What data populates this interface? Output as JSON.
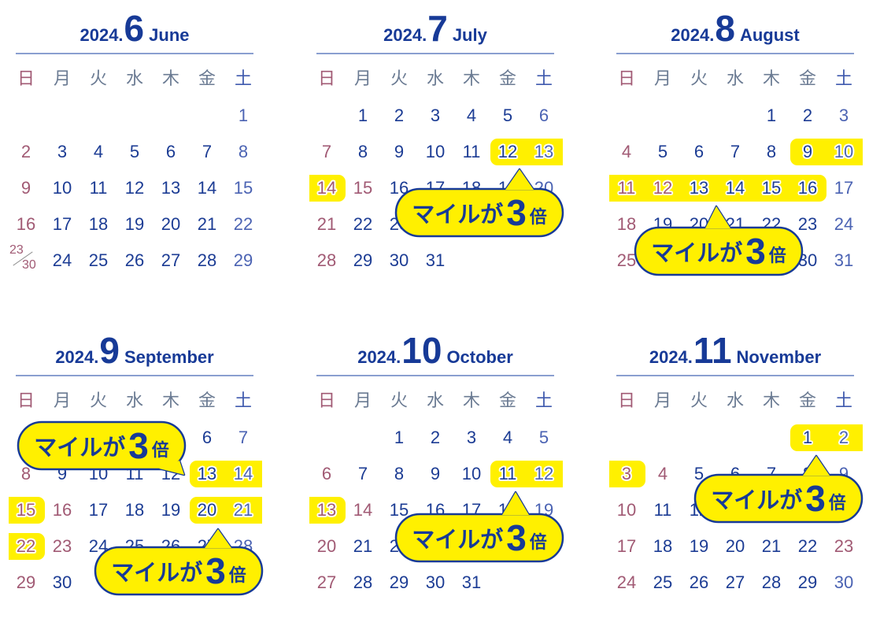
{
  "weekdays": [
    "日",
    "月",
    "火",
    "水",
    "木",
    "金",
    "土"
  ],
  "callout": {
    "prefix": "マイルが",
    "number": "3",
    "suffix": "倍"
  },
  "colors": {
    "weekday": "#1c3c94",
    "saturday": "#4b63b3",
    "sunday_holiday": "#a15a74",
    "highlight": "#fff000",
    "callout_fill": "#fff000",
    "callout_border": "#173a97"
  },
  "months": [
    {
      "year_label": "2024.",
      "month_number": "6",
      "month_name": "June",
      "first_weekday": 6,
      "days": 30,
      "holidays": [],
      "highlight_days": [],
      "callouts": 0
    },
    {
      "year_label": "2024.",
      "month_number": "7",
      "month_name": "July",
      "first_weekday": 1,
      "days": 31,
      "holidays": [
        15
      ],
      "highlight_days": [
        12,
        13,
        14
      ],
      "callouts": 1
    },
    {
      "year_label": "2024.",
      "month_number": "8",
      "month_name": "August",
      "first_weekday": 4,
      "days": 31,
      "holidays": [
        12
      ],
      "highlight_days": [
        9,
        10,
        11,
        12,
        13,
        14,
        15,
        16
      ],
      "callouts": 1
    },
    {
      "year_label": "2024.",
      "month_number": "9",
      "month_name": "September",
      "first_weekday": 0,
      "days": 30,
      "holidays": [
        16,
        23
      ],
      "highlight_days": [
        13,
        14,
        15,
        20,
        21,
        22
      ],
      "callouts": 2
    },
    {
      "year_label": "2024.",
      "month_number": "10",
      "month_name": "October",
      "first_weekday": 2,
      "days": 31,
      "holidays": [
        14
      ],
      "highlight_days": [
        11,
        12,
        13
      ],
      "callouts": 1
    },
    {
      "year_label": "2024.",
      "month_number": "11",
      "month_name": "November",
      "first_weekday": 5,
      "days": 30,
      "holidays": [
        4,
        23
      ],
      "highlight_days": [
        1,
        2,
        3
      ],
      "callouts": 1
    }
  ]
}
